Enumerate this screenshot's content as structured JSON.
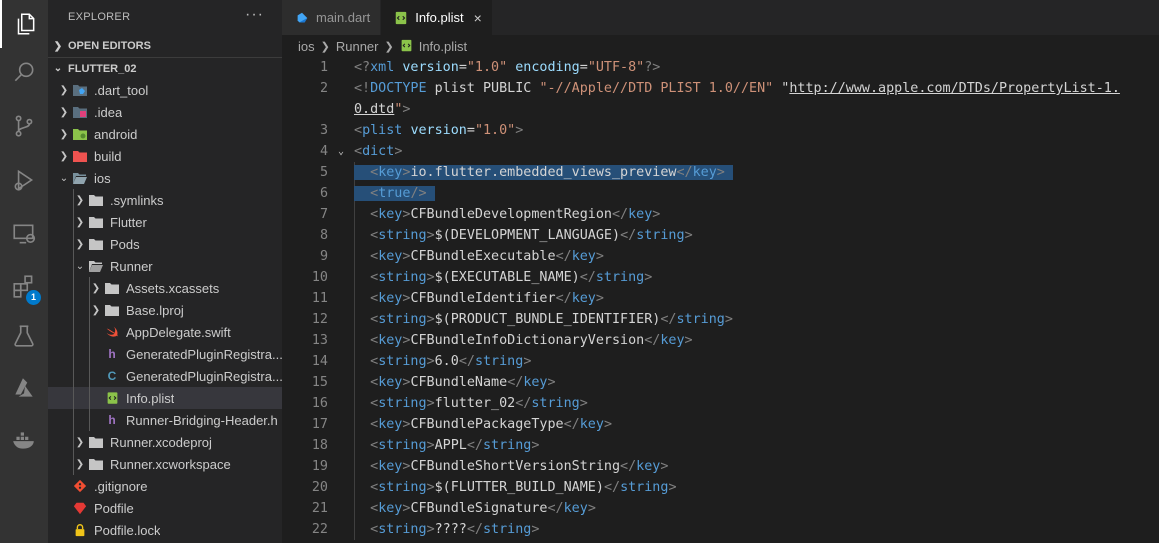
{
  "activity_bar": {
    "items": [
      "explorer-icon",
      "search-icon",
      "source-control-icon",
      "run-debug-icon",
      "remote-explorer-icon",
      "extensions-icon",
      "testing-icon",
      "azure-icon",
      "docker-icon"
    ],
    "extensions_badge": "1"
  },
  "explorer": {
    "title": "EXPLORER",
    "more": "···",
    "open_editors": "OPEN EDITORS",
    "project": "FLUTTER_02",
    "tree": [
      {
        "label": ".dart_tool",
        "icon": "folder-dart",
        "depth": 1,
        "expanded": false
      },
      {
        "label": ".idea",
        "icon": "folder-idea",
        "depth": 1,
        "expanded": false
      },
      {
        "label": "android",
        "icon": "folder-android",
        "depth": 1,
        "expanded": false
      },
      {
        "label": "build",
        "icon": "folder-build",
        "depth": 1,
        "expanded": false
      },
      {
        "label": "ios",
        "icon": "folder-ios",
        "depth": 1,
        "expanded": true
      },
      {
        "label": ".symlinks",
        "icon": "folder",
        "depth": 2,
        "expanded": false
      },
      {
        "label": "Flutter",
        "icon": "folder",
        "depth": 2,
        "expanded": false
      },
      {
        "label": "Pods",
        "icon": "folder",
        "depth": 2,
        "expanded": false
      },
      {
        "label": "Runner",
        "icon": "folder-open",
        "depth": 2,
        "expanded": true
      },
      {
        "label": "Assets.xcassets",
        "icon": "folder",
        "depth": 3,
        "expanded": false
      },
      {
        "label": "Base.lproj",
        "icon": "folder",
        "depth": 3,
        "expanded": false
      },
      {
        "label": "AppDelegate.swift",
        "icon": "swift",
        "depth": 3
      },
      {
        "label": "GeneratedPluginRegistra...",
        "icon": "h",
        "depth": 3
      },
      {
        "label": "GeneratedPluginRegistra...",
        "icon": "c",
        "depth": 3
      },
      {
        "label": "Info.plist",
        "icon": "plist",
        "depth": 3,
        "selected": true
      },
      {
        "label": "Runner-Bridging-Header.h",
        "icon": "h",
        "depth": 3
      },
      {
        "label": "Runner.xcodeproj",
        "icon": "folder",
        "depth": 2,
        "expanded": false
      },
      {
        "label": "Runner.xcworkspace",
        "icon": "folder",
        "depth": 2,
        "expanded": false
      },
      {
        "label": ".gitignore",
        "icon": "git",
        "depth": 1
      },
      {
        "label": "Podfile",
        "icon": "ruby",
        "depth": 1
      },
      {
        "label": "Podfile.lock",
        "icon": "lock",
        "depth": 1
      }
    ]
  },
  "tabs": [
    {
      "label": "main.dart",
      "icon": "dart",
      "active": false
    },
    {
      "label": "Info.plist",
      "icon": "plist",
      "active": true,
      "close": "×"
    }
  ],
  "breadcrumb": [
    "ios",
    "Runner",
    "Info.plist"
  ],
  "editor": {
    "lines": [
      {
        "n": "1",
        "indent": 0,
        "parts": [
          [
            "p",
            "<?"
          ],
          [
            "t",
            "xml "
          ],
          [
            "a",
            "version"
          ],
          [
            "d",
            "="
          ],
          [
            "s",
            "\"1.0\""
          ],
          [
            "d",
            " "
          ],
          [
            "a",
            "encoding"
          ],
          [
            "d",
            "="
          ],
          [
            "s",
            "\"UTF-8\""
          ],
          [
            "p",
            "?>"
          ]
        ]
      },
      {
        "n": "2",
        "indent": 0,
        "parts": [
          [
            "p",
            "<!"
          ],
          [
            "t",
            "DOCTYPE"
          ],
          [
            "d",
            " plist PUBLIC "
          ],
          [
            "s",
            "\"-//Apple//DTD PLIST 1.0//EN\""
          ],
          [
            "d",
            " \""
          ],
          [
            "u",
            "http://www.apple.com/DTDs/PropertyList-1."
          ]
        ]
      },
      {
        "n": "",
        "indent": 0,
        "parts": [
          [
            "u",
            "0.dtd"
          ],
          [
            "s",
            "\""
          ],
          [
            "p",
            ">"
          ]
        ]
      },
      {
        "n": "3",
        "indent": 0,
        "parts": [
          [
            "p",
            "<"
          ],
          [
            "t",
            "plist"
          ],
          [
            "d",
            " "
          ],
          [
            "a",
            "version"
          ],
          [
            "d",
            "="
          ],
          [
            "s",
            "\"1.0\""
          ],
          [
            "p",
            ">"
          ]
        ]
      },
      {
        "n": "4",
        "indent": 0,
        "fold": "⌄",
        "parts": [
          [
            "p",
            "<"
          ],
          [
            "t",
            "dict"
          ],
          [
            "p",
            ">"
          ]
        ]
      },
      {
        "n": "5",
        "indent": 1,
        "selected": true,
        "parts": [
          [
            "p",
            "<"
          ],
          [
            "t",
            "key"
          ],
          [
            "p",
            ">"
          ],
          [
            "d",
            "io.flutter.embedded_views_preview"
          ],
          [
            "p",
            "</"
          ],
          [
            "t",
            "key"
          ],
          [
            "p",
            ">"
          ]
        ]
      },
      {
        "n": "6",
        "indent": 1,
        "selected": true,
        "parts": [
          [
            "p",
            "<"
          ],
          [
            "t",
            "true"
          ],
          [
            "p",
            "/>"
          ]
        ]
      },
      {
        "n": "7",
        "indent": 1,
        "parts": [
          [
            "p",
            "<"
          ],
          [
            "t",
            "key"
          ],
          [
            "p",
            ">"
          ],
          [
            "d",
            "CFBundleDevelopmentRegion"
          ],
          [
            "p",
            "</"
          ],
          [
            "t",
            "key"
          ],
          [
            "p",
            ">"
          ]
        ]
      },
      {
        "n": "8",
        "indent": 1,
        "parts": [
          [
            "p",
            "<"
          ],
          [
            "t",
            "string"
          ],
          [
            "p",
            ">"
          ],
          [
            "d",
            "$(DEVELOPMENT_LANGUAGE)"
          ],
          [
            "p",
            "</"
          ],
          [
            "t",
            "string"
          ],
          [
            "p",
            ">"
          ]
        ]
      },
      {
        "n": "9",
        "indent": 1,
        "parts": [
          [
            "p",
            "<"
          ],
          [
            "t",
            "key"
          ],
          [
            "p",
            ">"
          ],
          [
            "d",
            "CFBundleExecutable"
          ],
          [
            "p",
            "</"
          ],
          [
            "t",
            "key"
          ],
          [
            "p",
            ">"
          ]
        ]
      },
      {
        "n": "10",
        "indent": 1,
        "parts": [
          [
            "p",
            "<"
          ],
          [
            "t",
            "string"
          ],
          [
            "p",
            ">"
          ],
          [
            "d",
            "$(EXECUTABLE_NAME)"
          ],
          [
            "p",
            "</"
          ],
          [
            "t",
            "string"
          ],
          [
            "p",
            ">"
          ]
        ]
      },
      {
        "n": "11",
        "indent": 1,
        "parts": [
          [
            "p",
            "<"
          ],
          [
            "t",
            "key"
          ],
          [
            "p",
            ">"
          ],
          [
            "d",
            "CFBundleIdentifier"
          ],
          [
            "p",
            "</"
          ],
          [
            "t",
            "key"
          ],
          [
            "p",
            ">"
          ]
        ]
      },
      {
        "n": "12",
        "indent": 1,
        "parts": [
          [
            "p",
            "<"
          ],
          [
            "t",
            "string"
          ],
          [
            "p",
            ">"
          ],
          [
            "d",
            "$(PRODUCT_BUNDLE_IDENTIFIER)"
          ],
          [
            "p",
            "</"
          ],
          [
            "t",
            "string"
          ],
          [
            "p",
            ">"
          ]
        ]
      },
      {
        "n": "13",
        "indent": 1,
        "parts": [
          [
            "p",
            "<"
          ],
          [
            "t",
            "key"
          ],
          [
            "p",
            ">"
          ],
          [
            "d",
            "CFBundleInfoDictionaryVersion"
          ],
          [
            "p",
            "</"
          ],
          [
            "t",
            "key"
          ],
          [
            "p",
            ">"
          ]
        ]
      },
      {
        "n": "14",
        "indent": 1,
        "parts": [
          [
            "p",
            "<"
          ],
          [
            "t",
            "string"
          ],
          [
            "p",
            ">"
          ],
          [
            "d",
            "6.0"
          ],
          [
            "p",
            "</"
          ],
          [
            "t",
            "string"
          ],
          [
            "p",
            ">"
          ]
        ]
      },
      {
        "n": "15",
        "indent": 1,
        "parts": [
          [
            "p",
            "<"
          ],
          [
            "t",
            "key"
          ],
          [
            "p",
            ">"
          ],
          [
            "d",
            "CFBundleName"
          ],
          [
            "p",
            "</"
          ],
          [
            "t",
            "key"
          ],
          [
            "p",
            ">"
          ]
        ]
      },
      {
        "n": "16",
        "indent": 1,
        "parts": [
          [
            "p",
            "<"
          ],
          [
            "t",
            "string"
          ],
          [
            "p",
            ">"
          ],
          [
            "d",
            "flutter_02"
          ],
          [
            "p",
            "</"
          ],
          [
            "t",
            "string"
          ],
          [
            "p",
            ">"
          ]
        ]
      },
      {
        "n": "17",
        "indent": 1,
        "parts": [
          [
            "p",
            "<"
          ],
          [
            "t",
            "key"
          ],
          [
            "p",
            ">"
          ],
          [
            "d",
            "CFBundlePackageType"
          ],
          [
            "p",
            "</"
          ],
          [
            "t",
            "key"
          ],
          [
            "p",
            ">"
          ]
        ]
      },
      {
        "n": "18",
        "indent": 1,
        "parts": [
          [
            "p",
            "<"
          ],
          [
            "t",
            "string"
          ],
          [
            "p",
            ">"
          ],
          [
            "d",
            "APPL"
          ],
          [
            "p",
            "</"
          ],
          [
            "t",
            "string"
          ],
          [
            "p",
            ">"
          ]
        ]
      },
      {
        "n": "19",
        "indent": 1,
        "parts": [
          [
            "p",
            "<"
          ],
          [
            "t",
            "key"
          ],
          [
            "p",
            ">"
          ],
          [
            "d",
            "CFBundleShortVersionString"
          ],
          [
            "p",
            "</"
          ],
          [
            "t",
            "key"
          ],
          [
            "p",
            ">"
          ]
        ]
      },
      {
        "n": "20",
        "indent": 1,
        "parts": [
          [
            "p",
            "<"
          ],
          [
            "t",
            "string"
          ],
          [
            "p",
            ">"
          ],
          [
            "d",
            "$(FLUTTER_BUILD_NAME)"
          ],
          [
            "p",
            "</"
          ],
          [
            "t",
            "string"
          ],
          [
            "p",
            ">"
          ]
        ]
      },
      {
        "n": "21",
        "indent": 1,
        "parts": [
          [
            "p",
            "<"
          ],
          [
            "t",
            "key"
          ],
          [
            "p",
            ">"
          ],
          [
            "d",
            "CFBundleSignature"
          ],
          [
            "p",
            "</"
          ],
          [
            "t",
            "key"
          ],
          [
            "p",
            ">"
          ]
        ]
      },
      {
        "n": "22",
        "indent": 1,
        "parts": [
          [
            "p",
            "<"
          ],
          [
            "t",
            "string"
          ],
          [
            "p",
            ">"
          ],
          [
            "d",
            "????"
          ],
          [
            "p",
            "</"
          ],
          [
            "t",
            "string"
          ],
          [
            "p",
            ">"
          ]
        ]
      }
    ]
  },
  "colors": {
    "activity_bar": "#333333",
    "sidebar": "#252526",
    "editor_bg": "#1e1e1e",
    "selection": "#264f78",
    "tag": "#569cd6",
    "attribute": "#9cdcfe",
    "string": "#ce9178"
  }
}
